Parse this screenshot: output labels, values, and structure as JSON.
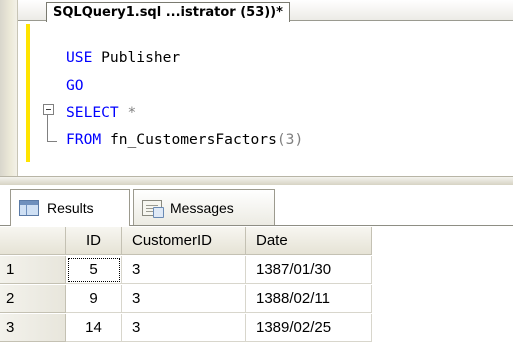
{
  "document_tab": {
    "label": "SQLQuery1.sql ...istrator (53))*"
  },
  "editor": {
    "line1": {
      "keyword": "USE",
      "rest": " Publisher"
    },
    "line2": {
      "keyword": "GO"
    },
    "line3": {
      "keyword": "SELECT",
      "rest": " *"
    },
    "line4": {
      "keyword": "FROM",
      "fn": " fn_CustomersFactors",
      "args": "(3)"
    }
  },
  "results_tabs": {
    "results_label": "Results",
    "messages_label": "Messages"
  },
  "grid": {
    "columns": [
      "ID",
      "CustomerID",
      "Date"
    ],
    "rows": [
      {
        "num": "1",
        "id": "5",
        "customer_id": "3",
        "date": "1387/01/30"
      },
      {
        "num": "2",
        "id": "9",
        "customer_id": "3",
        "date": "1388/02/11"
      },
      {
        "num": "3",
        "id": "14",
        "customer_id": "3",
        "date": "1389/02/25"
      }
    ]
  },
  "colors": {
    "keyword": "#0000ff",
    "change_bar": "#ffe400"
  }
}
